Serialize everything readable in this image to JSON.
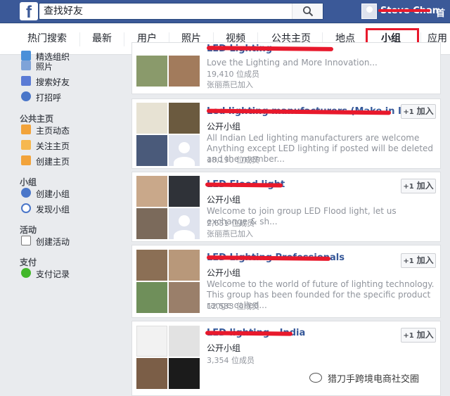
{
  "topbar": {
    "logo": "f",
    "search_placeholder": "查找好友",
    "search_value": "查找好友",
    "user_name": "Steve Chan",
    "home_label": "首"
  },
  "tabs": [
    {
      "label": "热门搜索"
    },
    {
      "label": "最新"
    },
    {
      "label": "用户"
    },
    {
      "label": "照片"
    },
    {
      "label": "视频"
    },
    {
      "label": "公共主页"
    },
    {
      "label": "地点"
    },
    {
      "label": "小组",
      "active": true
    },
    {
      "label": "应用"
    }
  ],
  "leftnav": {
    "items_top": [
      {
        "label": "精选组织",
        "icon": "video-icon"
      },
      {
        "label": "照片",
        "icon": "photo-icon"
      },
      {
        "label": "搜索好友",
        "icon": "friends-icon"
      },
      {
        "label": "打招呼",
        "icon": "poke-icon"
      }
    ],
    "pages_header": "公共主页",
    "pages_items": [
      {
        "label": "主页动态",
        "icon": "page-feed-icon"
      },
      {
        "label": "关注主页",
        "icon": "like-page-icon"
      },
      {
        "label": "创建主页",
        "icon": "create-page-icon"
      }
    ],
    "groups_header": "小组",
    "groups_items": [
      {
        "label": "创建小组",
        "icon": "create-group-icon"
      },
      {
        "label": "发现小组",
        "icon": "discover-group-icon"
      }
    ],
    "events_header": "活动",
    "events_items": [
      {
        "label": "创建活动",
        "icon": "create-event-icon"
      }
    ],
    "payments_header": "支付",
    "payments_items": [
      {
        "label": "支付记录",
        "icon": "payment-history-icon"
      }
    ]
  },
  "results": [
    {
      "name": "LED Lighting",
      "desc": "Love the Lighting and More Innovation...",
      "meta1": "19,410 位成员",
      "meta2": "张丽燕已加入"
    },
    {
      "name": "Led lighting manufacturers (Make in India)",
      "type": "公开小组",
      "desc": "All Indian Led lighting manufacturers are welcome Anything except LED lighting if posted will be deleted and the member...",
      "meta1": "18,190 位成员",
      "join_label": "加入",
      "join_plus": "+1"
    },
    {
      "name": "LED Flood light",
      "type": "公开小组",
      "desc": "Welcome to join group LED Flood light, let us exchange & sh...",
      "meta1": "2,651 位成员",
      "meta2": "张丽燕已加入",
      "join_label": "加入",
      "join_plus": "+1"
    },
    {
      "name": "LED Lighting Professionals",
      "type": "公开小组",
      "desc": "Welcome to the world of future of lighting technology. This group has been founded for the specific product range called...",
      "meta1": "12,533 位成员",
      "join_label": "加入",
      "join_plus": "+1"
    },
    {
      "name": "LED lighting - India",
      "type": "公开小组",
      "meta1": "3,354 位成员",
      "join_label": "加入",
      "join_plus": "+1"
    }
  ],
  "watermark": "猎刀手跨境电商社交圈",
  "colors": {
    "brand": "#3b5998",
    "link": "#365899",
    "redaction": "#e8192c"
  }
}
